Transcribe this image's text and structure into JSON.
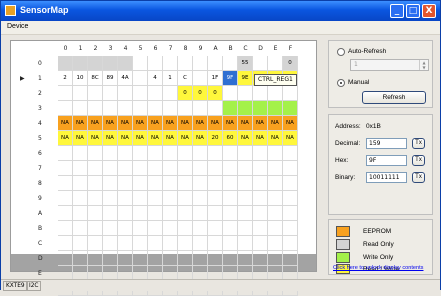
{
  "window": {
    "title": "SensorMap",
    "minimize": "_",
    "maximize": "□",
    "close": "X"
  },
  "menu": {
    "device": "Device"
  },
  "grid": {
    "columns": [
      "0",
      "1",
      "2",
      "3",
      "4",
      "5",
      "6",
      "7",
      "8",
      "9",
      "A",
      "B",
      "C",
      "D",
      "E",
      "F"
    ],
    "current_row_marker": "▶",
    "rows": [
      {
        "label": "0",
        "cells": [
          {
            "v": "",
            "t": "ro"
          },
          {
            "v": "",
            "t": "ro"
          },
          {
            "v": "",
            "t": "ro"
          },
          {
            "v": "",
            "t": "ro"
          },
          {
            "v": "",
            "t": "ro"
          },
          {
            "v": "",
            "t": ""
          },
          {
            "v": "",
            "t": ""
          },
          {
            "v": "",
            "t": ""
          },
          {
            "v": "",
            "t": ""
          },
          {
            "v": "",
            "t": ""
          },
          {
            "v": "",
            "t": ""
          },
          {
            "v": "",
            "t": ""
          },
          {
            "v": "55",
            "t": "ro"
          },
          {
            "v": "",
            "t": ""
          },
          {
            "v": "",
            "t": ""
          },
          {
            "v": "0",
            "t": "ro"
          }
        ]
      },
      {
        "label": "1",
        "cells": [
          {
            "v": "2",
            "t": ""
          },
          {
            "v": "10",
            "t": ""
          },
          {
            "v": "8C",
            "t": ""
          },
          {
            "v": "89",
            "t": ""
          },
          {
            "v": "4A",
            "t": ""
          },
          {
            "v": "",
            "t": ""
          },
          {
            "v": "4",
            "t": ""
          },
          {
            "v": "1",
            "t": ""
          },
          {
            "v": "C",
            "t": ""
          },
          {
            "v": "",
            "t": ""
          },
          {
            "v": "1F",
            "t": ""
          },
          {
            "v": "9F",
            "t": "sel"
          },
          {
            "v": "9E",
            "t": "rw"
          },
          {
            "v": "F",
            "t": "rw"
          },
          {
            "v": "10",
            "t": "rw"
          },
          {
            "v": "E0",
            "t": "rw"
          }
        ]
      },
      {
        "label": "2",
        "cells": [
          {
            "v": "",
            "t": ""
          },
          {
            "v": "",
            "t": ""
          },
          {
            "v": "",
            "t": ""
          },
          {
            "v": "",
            "t": ""
          },
          {
            "v": "",
            "t": ""
          },
          {
            "v": "",
            "t": ""
          },
          {
            "v": "",
            "t": ""
          },
          {
            "v": "",
            "t": ""
          },
          {
            "v": "0",
            "t": "rw"
          },
          {
            "v": "0",
            "t": "rw"
          },
          {
            "v": "0",
            "t": "rw"
          },
          {
            "v": "",
            "t": ""
          },
          {
            "v": "",
            "t": ""
          },
          {
            "v": "",
            "t": ""
          },
          {
            "v": "",
            "t": ""
          },
          {
            "v": "",
            "t": ""
          }
        ]
      },
      {
        "label": "3",
        "cells": [
          {
            "v": "",
            "t": ""
          },
          {
            "v": "",
            "t": ""
          },
          {
            "v": "",
            "t": ""
          },
          {
            "v": "",
            "t": ""
          },
          {
            "v": "",
            "t": ""
          },
          {
            "v": "",
            "t": ""
          },
          {
            "v": "",
            "t": ""
          },
          {
            "v": "",
            "t": ""
          },
          {
            "v": "",
            "t": ""
          },
          {
            "v": "",
            "t": ""
          },
          {
            "v": "",
            "t": ""
          },
          {
            "v": "",
            "t": "w"
          },
          {
            "v": "",
            "t": "w"
          },
          {
            "v": "",
            "t": "w"
          },
          {
            "v": "",
            "t": "w"
          },
          {
            "v": "",
            "t": "w"
          }
        ]
      },
      {
        "label": "4",
        "cells": [
          {
            "v": "NA",
            "t": "ee"
          },
          {
            "v": "NA",
            "t": "ee"
          },
          {
            "v": "NA",
            "t": "ee"
          },
          {
            "v": "NA",
            "t": "ee"
          },
          {
            "v": "NA",
            "t": "ee"
          },
          {
            "v": "NA",
            "t": "ee"
          },
          {
            "v": "NA",
            "t": "ee"
          },
          {
            "v": "NA",
            "t": "ee"
          },
          {
            "v": "NA",
            "t": "ee"
          },
          {
            "v": "NA",
            "t": "ee"
          },
          {
            "v": "NA",
            "t": "ee"
          },
          {
            "v": "NA",
            "t": "ee"
          },
          {
            "v": "NA",
            "t": "ee"
          },
          {
            "v": "NA",
            "t": "ee"
          },
          {
            "v": "NA",
            "t": "ee"
          },
          {
            "v": "NA",
            "t": "ee"
          }
        ]
      },
      {
        "label": "5",
        "cells": [
          {
            "v": "NA",
            "t": "rw"
          },
          {
            "v": "NA",
            "t": "rw"
          },
          {
            "v": "NA",
            "t": "rw"
          },
          {
            "v": "NA",
            "t": "rw"
          },
          {
            "v": "NA",
            "t": "rw"
          },
          {
            "v": "NA",
            "t": "rw"
          },
          {
            "v": "NA",
            "t": "rw"
          },
          {
            "v": "NA",
            "t": "rw"
          },
          {
            "v": "NA",
            "t": "rw"
          },
          {
            "v": "NA",
            "t": "rw"
          },
          {
            "v": "20",
            "t": "rw"
          },
          {
            "v": "60",
            "t": "rw"
          },
          {
            "v": "NA",
            "t": "rw"
          },
          {
            "v": "NA",
            "t": "rw"
          },
          {
            "v": "NA",
            "t": "rw"
          },
          {
            "v": "NA",
            "t": "rw"
          }
        ]
      },
      {
        "label": "6",
        "cells": []
      },
      {
        "label": "7",
        "cells": []
      },
      {
        "label": "8",
        "cells": []
      },
      {
        "label": "9",
        "cells": []
      },
      {
        "label": "A",
        "cells": []
      },
      {
        "label": "B",
        "cells": []
      },
      {
        "label": "C",
        "cells": []
      },
      {
        "label": "D",
        "cells": []
      },
      {
        "label": "E",
        "cells": []
      },
      {
        "label": "F",
        "cells": []
      }
    ],
    "tooltip": "CTRL_REG1"
  },
  "refresh_panel": {
    "auto_refresh_label": "Auto-Refresh",
    "interval_value": "1",
    "manual_label": "Manual",
    "refresh_button": "Refresh"
  },
  "register_panel": {
    "address_label": "Address:",
    "address_value": "0x1B",
    "decimal_label": "Decimal:",
    "decimal_value": "159",
    "hex_label": "Hex:",
    "hex_value": "9F",
    "binary_label": "Binary:",
    "binary_value": "10011111",
    "tx_label": "Tx"
  },
  "legend": {
    "items": [
      {
        "label": "EEPROM",
        "color": "#f8a11f"
      },
      {
        "label": "Read Only",
        "color": "#d4d4d4"
      },
      {
        "label": "Write Only",
        "color": "#a4f14a"
      },
      {
        "label": "Read / Write",
        "color": "#fff73c"
      }
    ]
  },
  "unlock_link": "Click here to unlock display contents",
  "status": {
    "device": "KXTE9",
    "bus": "I2C"
  }
}
